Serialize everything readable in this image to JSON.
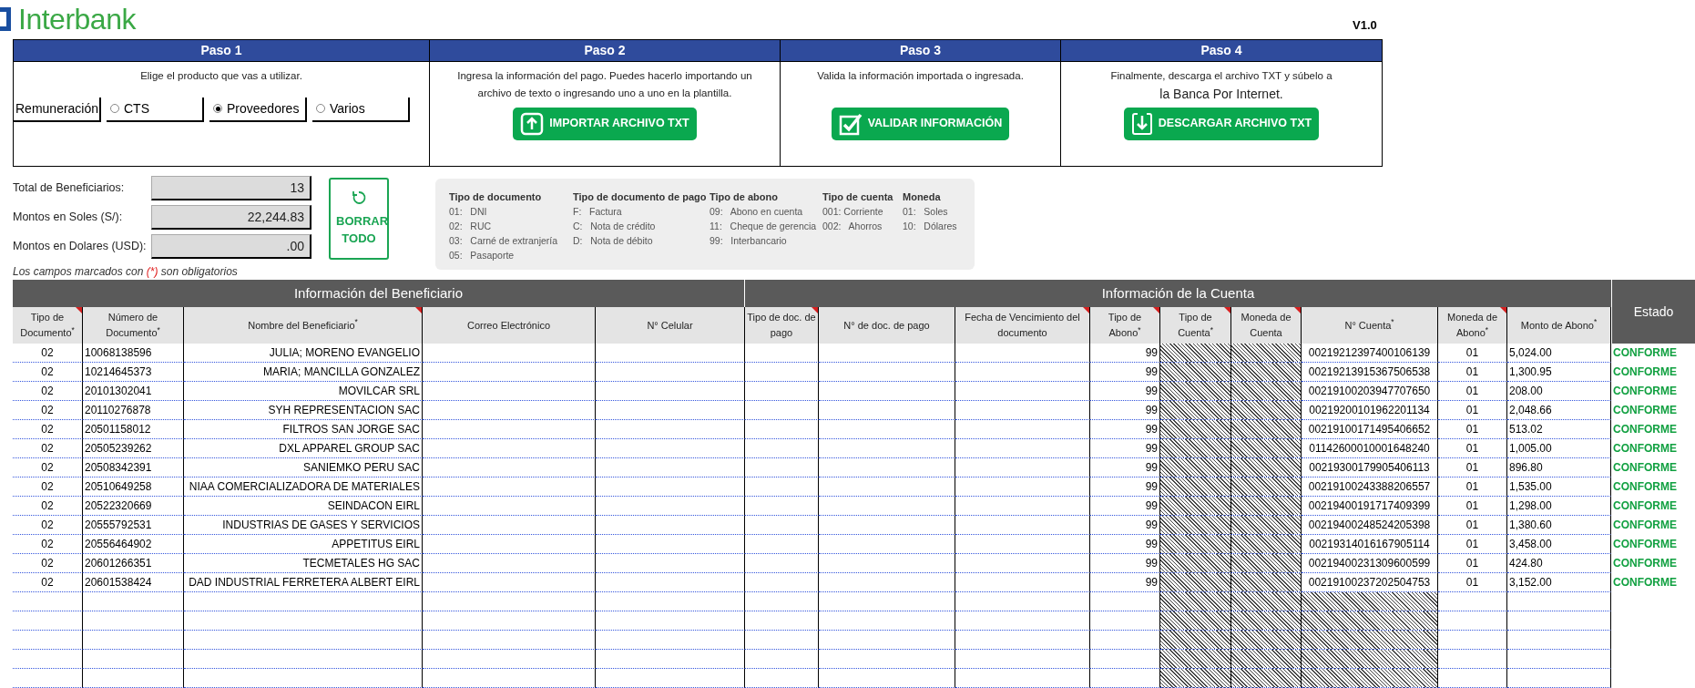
{
  "logo": {
    "name": "Interbank"
  },
  "version": "V1.0",
  "steps": [
    {
      "title": "Paso 1",
      "lines": [
        "Elige el producto que vas a utilizar."
      ],
      "options": [
        {
          "label": "Remuneración",
          "kind": "button",
          "selected": false
        },
        {
          "label": "CTS",
          "kind": "radio",
          "selected": false
        },
        {
          "label": "Proveedores",
          "kind": "radio",
          "selected": true
        },
        {
          "label": "Varios",
          "kind": "radio",
          "selected": false
        }
      ]
    },
    {
      "title": "Paso 2",
      "lines": [
        "Ingresa la información del pago. Puedes hacerlo importando un",
        "archivo de texto o ingresando uno a uno en la plantilla."
      ],
      "action": {
        "label": "IMPORTAR ARCHIVO TXT",
        "kind": "upload"
      }
    },
    {
      "title": "Paso 3",
      "lines": [
        "Valida la información importada o ingresada."
      ],
      "action": {
        "label": "VALIDAR INFORMACIÓN",
        "kind": "check"
      }
    },
    {
      "title": "Paso 4",
      "lines": [
        "Finalmente, descarga el archivo TXT  y súbelo a",
        "la Banca Por Internet."
      ],
      "action": {
        "label": "DESCARGAR ARCHIVO TXT",
        "kind": "download"
      }
    }
  ],
  "summary": [
    {
      "label": "Total de Beneficiarios:",
      "value": "13"
    },
    {
      "label": "Montos en Soles (S/):",
      "value": "22,244.83"
    },
    {
      "label": "Montos en Dolares (USD):",
      "value": ".00"
    }
  ],
  "clear_button": {
    "label": "BORRAR TODO"
  },
  "required_note": {
    "before": "Los campos marcados con",
    "mark": "(*)",
    "after": "son obligatorios"
  },
  "legend": [
    {
      "title": "Tipo de documento",
      "items": [
        "01:   DNI",
        "02:   RUC",
        "03:   Carné de extranjería",
        "05:   Pasaporte"
      ]
    },
    {
      "title": "Tipo de documento de pago",
      "items": [
        "F:   Factura",
        "C:   Nota de crédito",
        "D:   Nota de débito"
      ]
    },
    {
      "title": "Tipo de abono",
      "items": [
        "09:   Abono en cuenta",
        "11:   Cheque de gerencia",
        "99:   Interbancario"
      ]
    },
    {
      "title": "Tipo de cuenta",
      "items": [
        "001: Corriente",
        "002:   Ahorros"
      ]
    },
    {
      "title": "Moneda",
      "items": [
        "01:   Soles",
        "10:   Dólares"
      ]
    }
  ],
  "table": {
    "sections": [
      "Información del Beneficiario",
      "Información de la Cuenta"
    ],
    "columns": [
      {
        "label": "Tipo de Documento$^{*}$",
        "comment": true
      },
      {
        "label": "Número de Documento$^{*}$",
        "comment": false
      },
      {
        "label": "Nombre del Beneficiario$^{*}$",
        "comment": true
      },
      {
        "label": "Correo Electrónico",
        "comment": false
      },
      {
        "label": "N° Celular",
        "comment": false
      },
      {
        "label": "Tipo de doc. de pago",
        "comment": true
      },
      {
        "label": "N° de doc. de pago",
        "comment": false
      },
      {
        "label": "Fecha de Vencimiento del documento",
        "comment": true
      },
      {
        "label": "Tipo de Abono$^{*}$",
        "comment": true
      },
      {
        "label": "Tipo de Cuenta$^{*}$",
        "comment": true
      },
      {
        "label": "Moneda de Cuenta",
        "comment": true
      },
      {
        "label": "N° Cuenta$^{*}$",
        "comment": false
      },
      {
        "label": "Moneda de Abono$^{*}$",
        "comment": true
      },
      {
        "label": "Monto de Abono$^{*}$",
        "comment": false
      },
      {
        "label": "Estado",
        "comment": false
      }
    ],
    "rows": [
      {
        "tipo_documento": "02",
        "numero_documento": "10068138596",
        "nombre": "JULIA; MORENO EVANGELIO",
        "tipo_abono": "99",
        "numero_cuenta": "00219212397400106139",
        "moneda_abono": "01",
        "monto": "5,024.00",
        "estado": "CONFORME"
      },
      {
        "tipo_documento": "02",
        "numero_documento": "10214645373",
        "nombre": "MARIA; MANCILLA GONZALEZ",
        "tipo_abono": "99",
        "numero_cuenta": "00219213915367506538",
        "moneda_abono": "01",
        "monto": "1,300.95",
        "estado": "CONFORME"
      },
      {
        "tipo_documento": "02",
        "numero_documento": "20101302041",
        "nombre": "MOVILCAR SRL",
        "tipo_abono": "99",
        "numero_cuenta": "00219100203947707650",
        "moneda_abono": "01",
        "monto": "208.00",
        "estado": "CONFORME"
      },
      {
        "tipo_documento": "02",
        "numero_documento": "20110276878",
        "nombre": "SYH REPRESENTACION SAC",
        "tipo_abono": "99",
        "numero_cuenta": "00219200101962201134",
        "moneda_abono": "01",
        "monto": "2,048.66",
        "estado": "CONFORME"
      },
      {
        "tipo_documento": "02",
        "numero_documento": "20501158012",
        "nombre": "FILTROS SAN JORGE SAC",
        "tipo_abono": "99",
        "numero_cuenta": "00219100171495406652",
        "moneda_abono": "01",
        "monto": "513.02",
        "estado": "CONFORME"
      },
      {
        "tipo_documento": "02",
        "numero_documento": "20505239262",
        "nombre": "DXL APPAREL GROUP SAC",
        "tipo_abono": "99",
        "numero_cuenta": "01142600010001648240",
        "moneda_abono": "01",
        "monto": "1,005.00",
        "estado": "CONFORME"
      },
      {
        "tipo_documento": "02",
        "numero_documento": "20508342391",
        "nombre": "SANIEMKO PERU SAC",
        "tipo_abono": "99",
        "numero_cuenta": "00219300179905406113",
        "moneda_abono": "01",
        "monto": "896.80",
        "estado": "CONFORME"
      },
      {
        "tipo_documento": "02",
        "numero_documento": "20510649258",
        "nombre": "NIAA COMERCIALIZADORA DE MATERIALES",
        "tipo_abono": "99",
        "numero_cuenta": "00219100243388206557",
        "moneda_abono": "01",
        "monto": "1,535.00",
        "estado": "CONFORME"
      },
      {
        "tipo_documento": "02",
        "numero_documento": "20522320669",
        "nombre": "SEINDACON EIRL",
        "tipo_abono": "99",
        "numero_cuenta": "00219400191717409399",
        "moneda_abono": "01",
        "monto": "1,298.00",
        "estado": "CONFORME"
      },
      {
        "tipo_documento": "02",
        "numero_documento": "20555792531",
        "nombre": "INDUSTRIAS DE GASES Y SERVICIOS",
        "tipo_abono": "99",
        "numero_cuenta": "00219400248524205398",
        "moneda_abono": "01",
        "monto": "1,380.60",
        "estado": "CONFORME"
      },
      {
        "tipo_documento": "02",
        "numero_documento": "20556464902",
        "nombre": "APPETITUS EIRL",
        "tipo_abono": "99",
        "numero_cuenta": "00219314016167905114",
        "moneda_abono": "01",
        "monto": "3,458.00",
        "estado": "CONFORME"
      },
      {
        "tipo_documento": "02",
        "numero_documento": "20601266351",
        "nombre": "TECMETALES HG SAC",
        "tipo_abono": "99",
        "numero_cuenta": "00219400231309600599",
        "moneda_abono": "01",
        "monto": "424.80",
        "estado": "CONFORME"
      },
      {
        "tipo_documento": "02",
        "numero_documento": "20601538424",
        "nombre": "DAD INDUSTRIAL FERRETERA ALBERT EIRL",
        "tipo_abono": "99",
        "numero_cuenta": "00219100237202504753",
        "moneda_abono": "01",
        "monto": "3,152.00",
        "estado": "CONFORME"
      }
    ]
  }
}
